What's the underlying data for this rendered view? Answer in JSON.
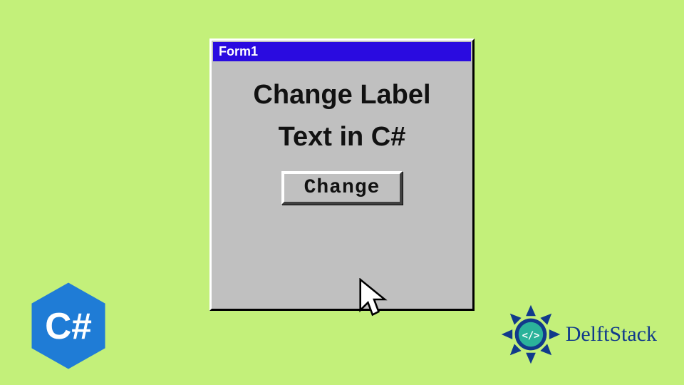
{
  "window": {
    "title": "Form1",
    "label": "Change Label Text in C#",
    "button_label": "Change"
  },
  "badges": {
    "csharp": "C#",
    "brand": "DelftStack"
  },
  "colors": {
    "background": "#c3f07a",
    "titlebar": "#2a0be0",
    "window_face": "#c0c0c0",
    "csharp_badge": "#1f7cd6",
    "brand_blue": "#113a8b",
    "brand_teal": "#2bb39a"
  }
}
